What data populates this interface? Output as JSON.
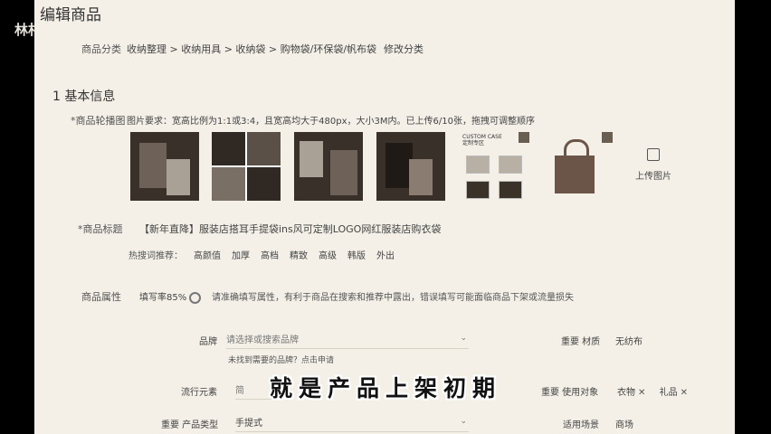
{
  "left_user": "林村",
  "page_title": "编辑商品",
  "category": {
    "label": "商品分类",
    "path": "收纳整理 > 收纳用具 > 收纳袋 > 购物袋/环保袋/帆布袋",
    "edit": "修改分类"
  },
  "section_title": "1  基本信息",
  "images": {
    "label": "*商品轮播图",
    "requirement": "图片要求：宽高比例为1:1或3:4，且宽高均大于480px，大小3M内。已上传6/10张，拖拽可调整顺序",
    "card_text": "CUSTOM CASE\n定制专区",
    "upload_label": "上传图片"
  },
  "product_title": {
    "label": "*商品标题",
    "value": "【新年直降】服装店搭耳手提袋ins风可定制LOGO网红服装店购衣袋"
  },
  "hot_search": {
    "label": "热搜词推荐：",
    "tags": [
      "高颜值",
      "加厚",
      "高档",
      "精致",
      "高级",
      "韩版",
      "外出"
    ]
  },
  "attributes": {
    "label": "商品属性",
    "fill_rate": "填写率85%",
    "hint": "请准确填写属性，有利于商品在搜索和推荐中露出，错误填写可能面临商品下架或流量损失"
  },
  "fields": {
    "brand_label": "品牌",
    "brand_placeholder": "请选择或搜索品牌",
    "brand_link": "未找到需要的品牌？点击申请",
    "material_label": "重要 材质",
    "material_value": "无纺布",
    "style_label": "流行元素",
    "style_value": "简",
    "target_label": "重要 使用对象",
    "target_chips": [
      "衣物",
      "礼品"
    ],
    "type_label": "重要 产品类型",
    "type_value": "手提式",
    "scene_label": "适用场景",
    "scene_value": "商场"
  },
  "subtitle": "就是产品上架初期"
}
